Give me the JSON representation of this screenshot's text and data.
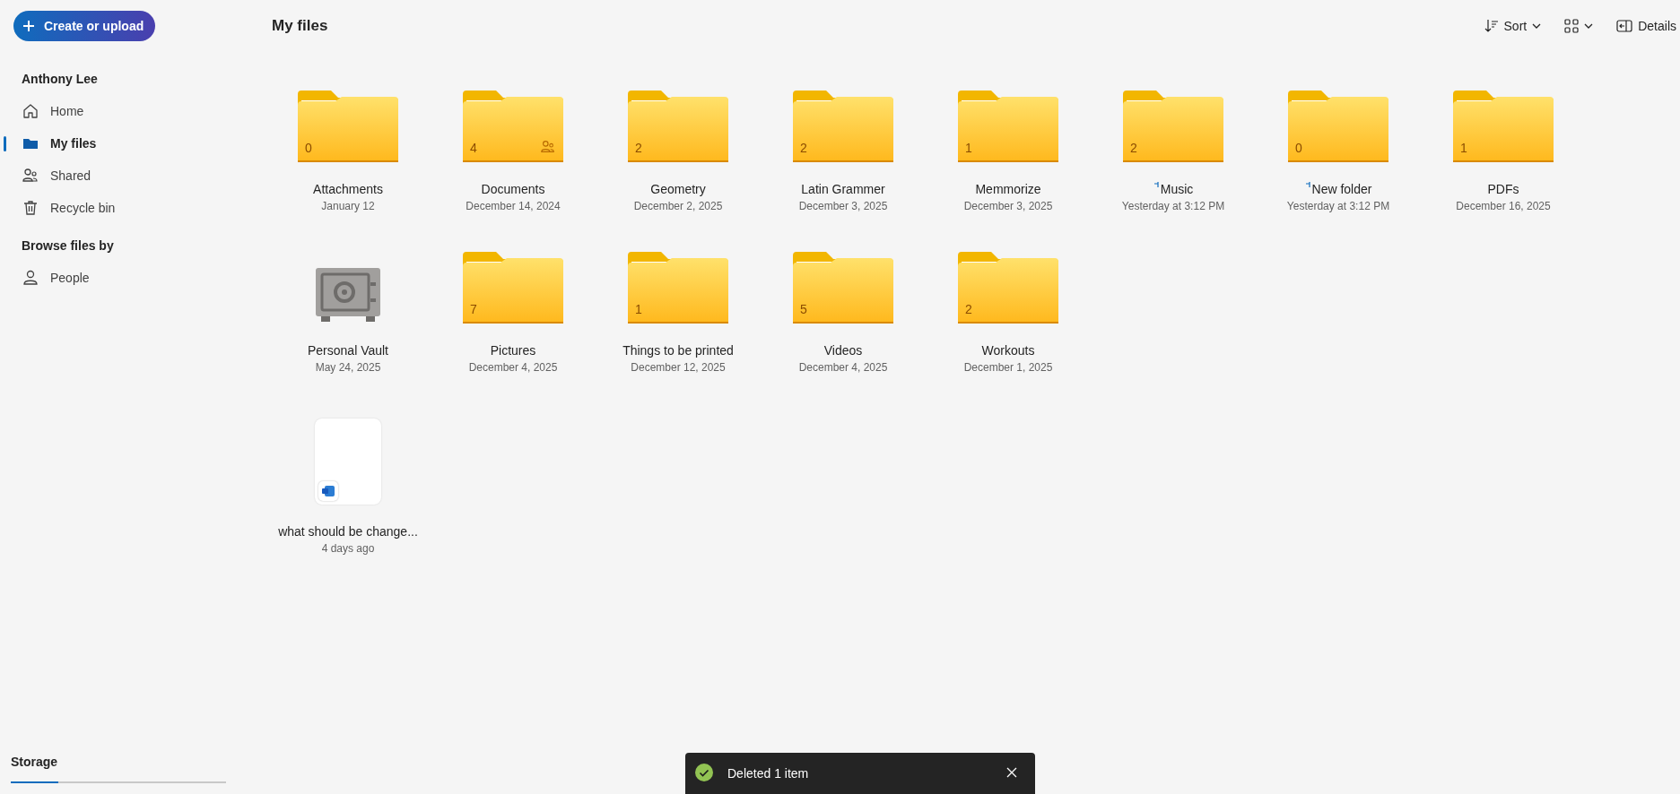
{
  "sidebar": {
    "create_button": "Create or upload",
    "account": "Anthony Lee",
    "nav": [
      {
        "label": "Home",
        "selected": false
      },
      {
        "label": "My files",
        "selected": true
      },
      {
        "label": "Shared",
        "selected": false
      },
      {
        "label": "Recycle bin",
        "selected": false
      }
    ],
    "browse_heading": "Browse files by",
    "browse": [
      {
        "label": "People",
        "selected": false
      }
    ],
    "storage": {
      "title": "Storage",
      "level": 0.22
    }
  },
  "header": {
    "title": "My files",
    "sort": "Sort",
    "details": "Details"
  },
  "items": [
    {
      "kind": "folder",
      "name": "Attachments",
      "date": "January 12",
      "count": "0",
      "shared": false,
      "syncing": false
    },
    {
      "kind": "folder",
      "name": "Documents",
      "date": "December 14, 2024",
      "count": "4",
      "shared": true,
      "syncing": false
    },
    {
      "kind": "folder",
      "name": "Geometry",
      "date": "December 2, 2025",
      "count": "2",
      "shared": false,
      "syncing": false
    },
    {
      "kind": "folder",
      "name": "Latin Grammer",
      "date": "December 3, 2025",
      "count": "2",
      "shared": false,
      "syncing": false
    },
    {
      "kind": "folder",
      "name": "Memmorize",
      "date": "December 3, 2025",
      "count": "1",
      "shared": false,
      "syncing": false
    },
    {
      "kind": "folder",
      "name": "Music",
      "date": "Yesterday at 3:12 PM",
      "count": "2",
      "shared": false,
      "syncing": true
    },
    {
      "kind": "folder",
      "name": "New folder",
      "date": "Yesterday at 3:12 PM",
      "count": "0",
      "shared": false,
      "syncing": true
    },
    {
      "kind": "folder",
      "name": "PDFs",
      "date": "December 16, 2025",
      "count": "1",
      "shared": false,
      "syncing": false
    },
    {
      "kind": "vault",
      "name": "Personal Vault",
      "date": "May 24, 2025"
    },
    {
      "kind": "folder",
      "name": "Pictures",
      "date": "December 4, 2025",
      "count": "7",
      "shared": false,
      "syncing": false
    },
    {
      "kind": "folder",
      "name": "Things to be printed",
      "date": "December 12, 2025",
      "count": "1",
      "shared": false,
      "syncing": false
    },
    {
      "kind": "folder",
      "name": "Videos",
      "date": "December 4, 2025",
      "count": "5",
      "shared": false,
      "syncing": false
    },
    {
      "kind": "folder",
      "name": "Workouts",
      "date": "December 1, 2025",
      "count": "2",
      "shared": false,
      "syncing": false
    },
    {
      "kind": "file",
      "name": "what should be change...",
      "date": "4 days ago"
    }
  ],
  "toast": {
    "message": "Deleted 1 item"
  }
}
